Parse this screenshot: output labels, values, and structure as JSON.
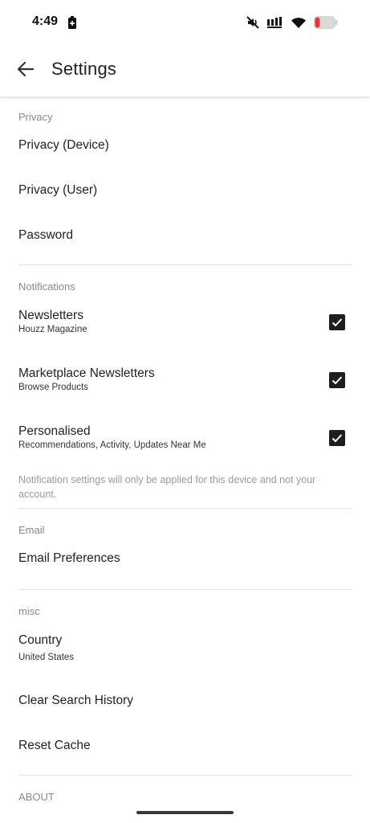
{
  "status_bar": {
    "time": "4:49",
    "icons": [
      "battery-saver-icon",
      "mute-icon",
      "signal-icon",
      "wifi-icon",
      "battery-icon"
    ]
  },
  "header": {
    "title": "Settings",
    "back_icon": "arrow-left-icon"
  },
  "sections": {
    "privacy": {
      "header": "Privacy",
      "items": [
        {
          "title": "Privacy (Device)"
        },
        {
          "title": "Privacy (User)"
        },
        {
          "title": "Password"
        }
      ]
    },
    "notifications": {
      "header": "Notifications",
      "items": [
        {
          "title": "Newsletters",
          "subtitle": "Houzz Magazine",
          "checked": true
        },
        {
          "title": "Marketplace Newsletters",
          "subtitle": "Browse Products",
          "checked": true
        },
        {
          "title": "Personalised",
          "subtitle": "Recommendations, Activity, Updates Near Me",
          "checked": true
        }
      ],
      "note": "Notification settings will only be applied for this device and not your account."
    },
    "email": {
      "header": "Email",
      "items": [
        {
          "title": "Email Preferences"
        }
      ]
    },
    "misc": {
      "header": "misc",
      "items": [
        {
          "title": "Country",
          "subtitle": "United States"
        },
        {
          "title": "Clear Search History"
        },
        {
          "title": "Reset Cache"
        }
      ]
    },
    "about": {
      "header": "ABOUT"
    }
  },
  "colors": {
    "checkbox": "#1e1e1e",
    "section_header": "#8a8a8a",
    "divider": "#e3e3e3",
    "note_text": "#9a9a9a"
  }
}
